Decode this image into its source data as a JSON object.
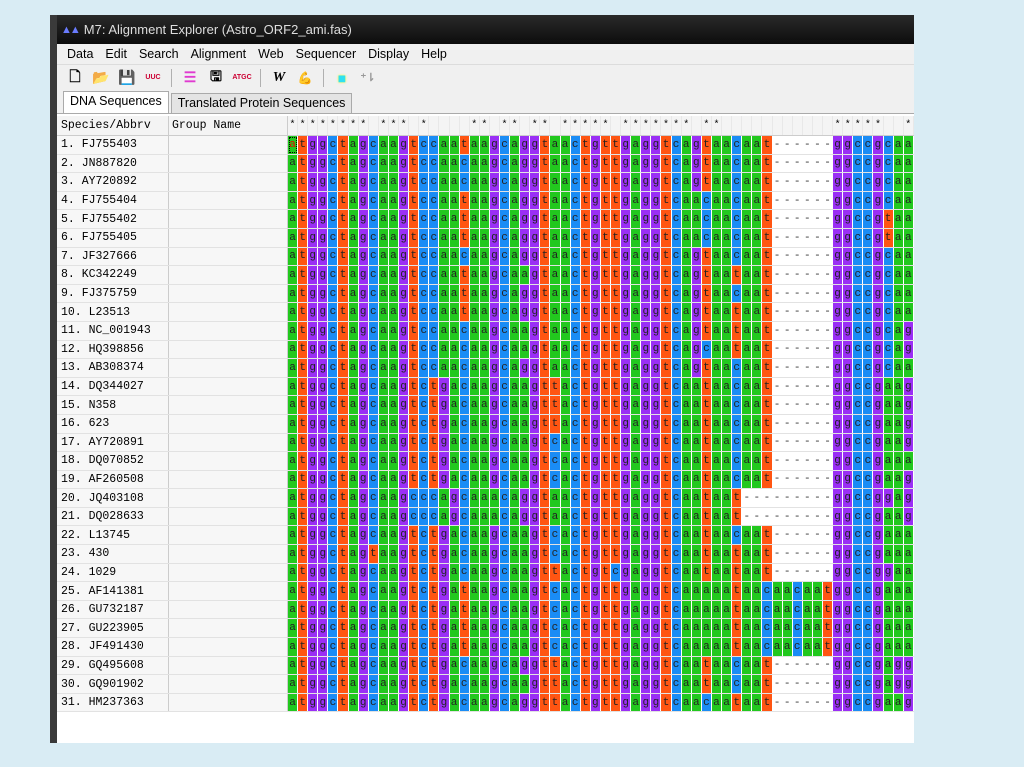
{
  "window": {
    "title": "M7: Alignment Explorer (Astro_ORF2_ami.fas)"
  },
  "menu": [
    "Data",
    "Edit",
    "Search",
    "Alignment",
    "Web",
    "Sequencer",
    "Display",
    "Help"
  ],
  "toolbar": [
    {
      "icon": "new-file-icon",
      "glyph": "🗋"
    },
    {
      "icon": "open-folder-icon",
      "glyph": "📂"
    },
    {
      "icon": "save-icon",
      "glyph": "💾"
    },
    {
      "icon": "translate-icon",
      "glyph": "UUC"
    },
    {
      "sep": true
    },
    {
      "icon": "align-icon",
      "glyph": "☰"
    },
    {
      "icon": "web-query-icon",
      "glyph": "🖫"
    },
    {
      "icon": "sequencer-icon",
      "glyph": "ATGC"
    },
    {
      "sep": true
    },
    {
      "icon": "clustalw-icon",
      "glyph": "W"
    },
    {
      "icon": "muscle-icon",
      "glyph": "💪"
    },
    {
      "sep": true
    },
    {
      "icon": "color-toggle-icon",
      "glyph": "■"
    },
    {
      "icon": "mark-site-icon",
      "glyph": "⁺⇂"
    }
  ],
  "tabs": [
    {
      "label": "DNA Sequences",
      "active": true
    },
    {
      "label": "Translated Protein Sequences",
      "active": false
    }
  ],
  "columns": {
    "name": "Species/Abbrv",
    "group": "Group Name"
  },
  "consensus": "******** *** *    ** ** ** ***** ******* **           *****  *",
  "base_colors": {
    "a": "#22c81e",
    "t": "#ff5512",
    "g": "#9a2ff5",
    "c": "#1a8cf5"
  },
  "sequences": [
    {
      "name": "1. FJ755403",
      "group": "",
      "seq": "atggctagcaagtccaataagcaggtaactgttgaggtcagtaacaat------ggccgcaa"
    },
    {
      "name": "2. JN887820",
      "group": "",
      "seq": "atggctagcaagtccaacaagcaggtaactgttgaggtcagtaacaat------ggccgcaa"
    },
    {
      "name": "3. AY720892",
      "group": "",
      "seq": "atggctagcaagtccaacaagcaggtaactgttgaggtcagtaacaat------ggccgcaa"
    },
    {
      "name": "4. FJ755404",
      "group": "",
      "seq": "atggctagcaagtccaataagcaggtaactgttgaggtcaacaacaat------ggccgcaa"
    },
    {
      "name": "5. FJ755402",
      "group": "",
      "seq": "atggctagcaagtccaataagcaggtaactgttgaggtcaacaacaat------ggccgtaa"
    },
    {
      "name": "6. FJ755405",
      "group": "",
      "seq": "atggctagcaagtccaataagcaggtaactgttgaggtcaacaacaat------ggccgtaa"
    },
    {
      "name": "7. JF327666",
      "group": "",
      "seq": "atggctagcaagtccaacaagcaggtaactgttgaggtcagtaacaat------ggccgcaa"
    },
    {
      "name": "8. KC342249",
      "group": "",
      "seq": "atggctagcaagtccaataagcaagtaactgttgaggtcagtaataat------ggccgcaa"
    },
    {
      "name": "9. FJ375759",
      "group": "",
      "seq": "atggctagcaagtccaataagcaggtaactgttgaggtcagtaacaat------ggccgcaa"
    },
    {
      "name": "10. L23513",
      "group": "",
      "seq": "atggctagcaagtccaataagcaggtaactgttgaggtcagtaataat------ggccgcaa"
    },
    {
      "name": "11. NC_001943",
      "group": "",
      "seq": "atggctagcaagtccaacaagcaagtaactgttgaggtcagtaataat------ggccgcag"
    },
    {
      "name": "12. HQ398856",
      "group": "",
      "seq": "atggctagcaagtccaacaagcaagtaactgttgaggtcagcaataat------ggccgcag"
    },
    {
      "name": "13. AB308374",
      "group": "",
      "seq": "atggctagcaagtccaacaagcaggtaactgttgaggtcagtaacaat------ggccgcaa"
    },
    {
      "name": "14. DQ344027",
      "group": "",
      "seq": "atggctagcaagtctgacaagcaagttactgttgaggtcaataacaat------ggccgaag"
    },
    {
      "name": "15. N358",
      "group": "",
      "seq": "atggctagcaagtctgacaagcaagttactgttgaggtcaataacaat------ggccgaag"
    },
    {
      "name": "16. 623",
      "group": "",
      "seq": "atggctagcaagtctgacaagcaagttactgttgaggtcaataacaat------ggccgaag"
    },
    {
      "name": "17. AY720891",
      "group": "",
      "seq": "atggctagcaagtctgacaagcaagtcactgttgaggtcaataacaat------ggccgaag"
    },
    {
      "name": "18. DQ070852",
      "group": "",
      "seq": "atggctagcaagtctgacaagcaagtcactgttgaggtcaataacaat------ggccgaaa"
    },
    {
      "name": "19. AF260508",
      "group": "",
      "seq": "atggctagcaagtctgacaagcaagtcactgttgaggtcaataacaat------ggccgaag"
    },
    {
      "name": "20. JQ403108",
      "group": "",
      "seq": "atggctagcaagcccagcaaacaggtaactgttgaggtcaataat---------ggccggag"
    },
    {
      "name": "21. DQ028633",
      "group": "",
      "seq": "atggctagcaagcccagcaaacaggtaactgttgaggtcaataat---------ggccgaag"
    },
    {
      "name": "22. L13745",
      "group": "",
      "seq": "atggctagcaagtctgacaagcaagtcactgttgaggtcaataacaat------ggccgaaa"
    },
    {
      "name": "23. 430",
      "group": "",
      "seq": "atggctagtaagtctgacaagcaagtcactgttgaggtcaataataat------ggccgaaa"
    },
    {
      "name": "24. 1029",
      "group": "",
      "seq": "atggctagcaagtctgacaagcaagttactgtcgaggtcaataataat------ggccggaa"
    },
    {
      "name": "25. AF141381",
      "group": "",
      "seq": "atggctagcaagtctgataagcaagtcactgttgaggtcaaaaataacaacaatggccgaaa"
    },
    {
      "name": "26. GU732187",
      "group": "",
      "seq": "atggctagcaagtctgataagcaagtcactgttgaggtcaaaaataacaacaatggccgaaa"
    },
    {
      "name": "27. GU223905",
      "group": "",
      "seq": "atggctagcaagtctgataagcaagtcactgttgaggtcaaaaataacaacaatggccgaaa"
    },
    {
      "name": "28. JF491430",
      "group": "",
      "seq": "atggctagcaagtctgataagcaagtcactgttgaggtcaaaaataacaacaatggccgaaa"
    },
    {
      "name": "29. GQ495608",
      "group": "",
      "seq": "atggctagcaagtctgacaagcaggttactgttgaggtcaataacaat------ggccgagg"
    },
    {
      "name": "30. GQ901902",
      "group": "",
      "seq": "atggctagcaagtctgacaagcaagttactgttgaggtcaataacaat------ggccgagg"
    },
    {
      "name": "31. HM237363",
      "group": "",
      "seq": "atggctagcaagtctgacaagcaggttactgttgaggtcaacaataat------ggccgaag"
    }
  ]
}
